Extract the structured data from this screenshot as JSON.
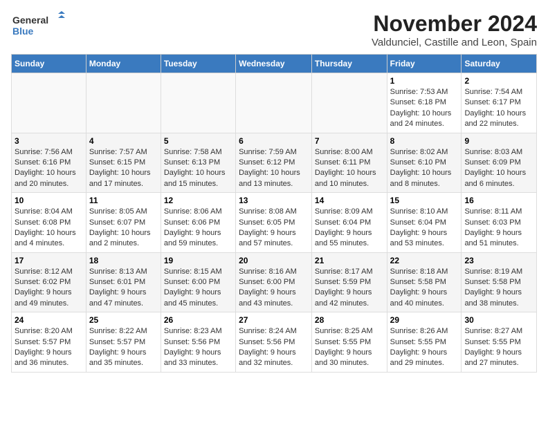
{
  "header": {
    "logo_line1": "General",
    "logo_line2": "Blue",
    "month": "November 2024",
    "location": "Valdunciel, Castille and Leon, Spain"
  },
  "weekdays": [
    "Sunday",
    "Monday",
    "Tuesday",
    "Wednesday",
    "Thursday",
    "Friday",
    "Saturday"
  ],
  "weeks": [
    [
      {
        "day": null
      },
      {
        "day": null
      },
      {
        "day": null
      },
      {
        "day": null
      },
      {
        "day": null
      },
      {
        "day": "1",
        "sunrise": "7:53 AM",
        "sunset": "6:18 PM",
        "daylight": "10 hours and 24 minutes."
      },
      {
        "day": "2",
        "sunrise": "7:54 AM",
        "sunset": "6:17 PM",
        "daylight": "10 hours and 22 minutes."
      }
    ],
    [
      {
        "day": "3",
        "sunrise": "7:56 AM",
        "sunset": "6:16 PM",
        "daylight": "10 hours and 20 minutes."
      },
      {
        "day": "4",
        "sunrise": "7:57 AM",
        "sunset": "6:15 PM",
        "daylight": "10 hours and 17 minutes."
      },
      {
        "day": "5",
        "sunrise": "7:58 AM",
        "sunset": "6:13 PM",
        "daylight": "10 hours and 15 minutes."
      },
      {
        "day": "6",
        "sunrise": "7:59 AM",
        "sunset": "6:12 PM",
        "daylight": "10 hours and 13 minutes."
      },
      {
        "day": "7",
        "sunrise": "8:00 AM",
        "sunset": "6:11 PM",
        "daylight": "10 hours and 10 minutes."
      },
      {
        "day": "8",
        "sunrise": "8:02 AM",
        "sunset": "6:10 PM",
        "daylight": "10 hours and 8 minutes."
      },
      {
        "day": "9",
        "sunrise": "8:03 AM",
        "sunset": "6:09 PM",
        "daylight": "10 hours and 6 minutes."
      }
    ],
    [
      {
        "day": "10",
        "sunrise": "8:04 AM",
        "sunset": "6:08 PM",
        "daylight": "10 hours and 4 minutes."
      },
      {
        "day": "11",
        "sunrise": "8:05 AM",
        "sunset": "6:07 PM",
        "daylight": "10 hours and 2 minutes."
      },
      {
        "day": "12",
        "sunrise": "8:06 AM",
        "sunset": "6:06 PM",
        "daylight": "9 hours and 59 minutes."
      },
      {
        "day": "13",
        "sunrise": "8:08 AM",
        "sunset": "6:05 PM",
        "daylight": "9 hours and 57 minutes."
      },
      {
        "day": "14",
        "sunrise": "8:09 AM",
        "sunset": "6:04 PM",
        "daylight": "9 hours and 55 minutes."
      },
      {
        "day": "15",
        "sunrise": "8:10 AM",
        "sunset": "6:04 PM",
        "daylight": "9 hours and 53 minutes."
      },
      {
        "day": "16",
        "sunrise": "8:11 AM",
        "sunset": "6:03 PM",
        "daylight": "9 hours and 51 minutes."
      }
    ],
    [
      {
        "day": "17",
        "sunrise": "8:12 AM",
        "sunset": "6:02 PM",
        "daylight": "9 hours and 49 minutes."
      },
      {
        "day": "18",
        "sunrise": "8:13 AM",
        "sunset": "6:01 PM",
        "daylight": "9 hours and 47 minutes."
      },
      {
        "day": "19",
        "sunrise": "8:15 AM",
        "sunset": "6:00 PM",
        "daylight": "9 hours and 45 minutes."
      },
      {
        "day": "20",
        "sunrise": "8:16 AM",
        "sunset": "6:00 PM",
        "daylight": "9 hours and 43 minutes."
      },
      {
        "day": "21",
        "sunrise": "8:17 AM",
        "sunset": "5:59 PM",
        "daylight": "9 hours and 42 minutes."
      },
      {
        "day": "22",
        "sunrise": "8:18 AM",
        "sunset": "5:58 PM",
        "daylight": "9 hours and 40 minutes."
      },
      {
        "day": "23",
        "sunrise": "8:19 AM",
        "sunset": "5:58 PM",
        "daylight": "9 hours and 38 minutes."
      }
    ],
    [
      {
        "day": "24",
        "sunrise": "8:20 AM",
        "sunset": "5:57 PM",
        "daylight": "9 hours and 36 minutes."
      },
      {
        "day": "25",
        "sunrise": "8:22 AM",
        "sunset": "5:57 PM",
        "daylight": "9 hours and 35 minutes."
      },
      {
        "day": "26",
        "sunrise": "8:23 AM",
        "sunset": "5:56 PM",
        "daylight": "9 hours and 33 minutes."
      },
      {
        "day": "27",
        "sunrise": "8:24 AM",
        "sunset": "5:56 PM",
        "daylight": "9 hours and 32 minutes."
      },
      {
        "day": "28",
        "sunrise": "8:25 AM",
        "sunset": "5:55 PM",
        "daylight": "9 hours and 30 minutes."
      },
      {
        "day": "29",
        "sunrise": "8:26 AM",
        "sunset": "5:55 PM",
        "daylight": "9 hours and 29 minutes."
      },
      {
        "day": "30",
        "sunrise": "8:27 AM",
        "sunset": "5:55 PM",
        "daylight": "9 hours and 27 minutes."
      }
    ]
  ]
}
